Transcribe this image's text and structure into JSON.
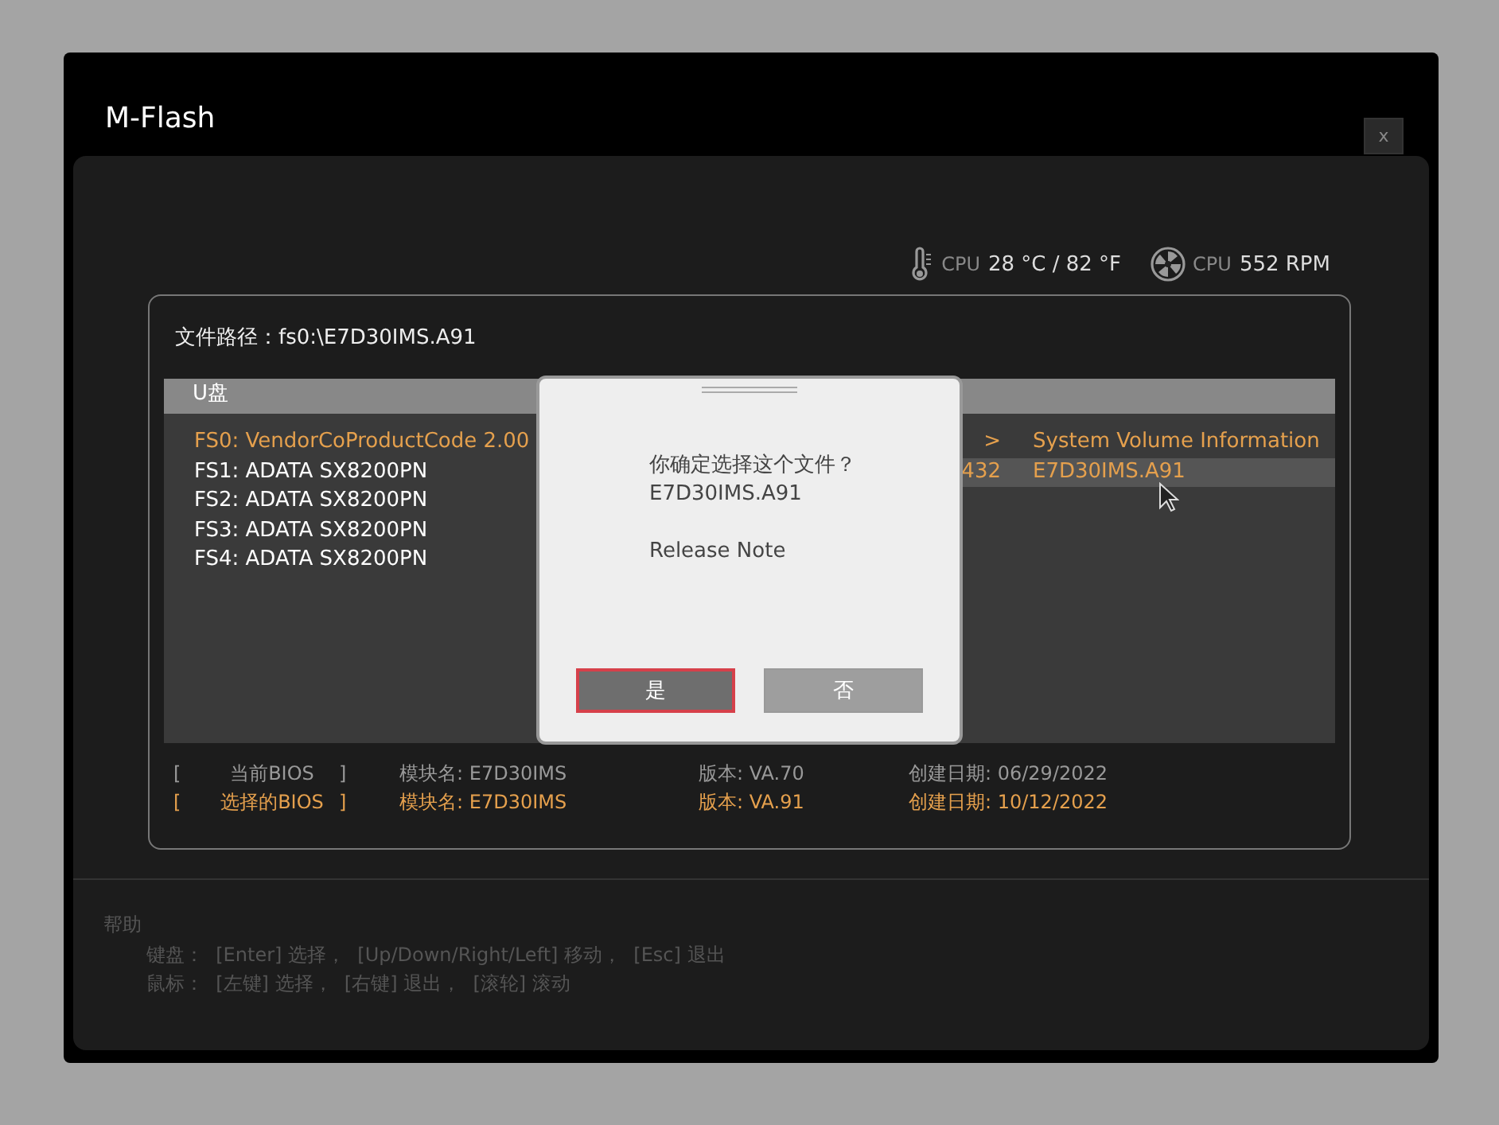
{
  "window": {
    "title": "M-Flash",
    "close": "x"
  },
  "sensors": [
    {
      "kind": "temperature",
      "label": "CPU",
      "value": "28 °C / 82 °F"
    },
    {
      "kind": "fan",
      "label": "CPU",
      "value": "552 RPM"
    }
  ],
  "file_path": "文件路径：fs0:\\E7D30IMS.A91",
  "drive_list": {
    "header": "U盘",
    "drives": [
      {
        "label": "FS0: VendorCoProductCode 2.00",
        "selected": true
      },
      {
        "label": "FS1: ADATA SX8200PN",
        "selected": false
      },
      {
        "label": "FS2: ADATA SX8200PN",
        "selected": false
      },
      {
        "label": "FS3: ADATA SX8200PN",
        "selected": false
      },
      {
        "label": "FS4: ADATA SX8200PN",
        "selected": false
      }
    ]
  },
  "files": [
    {
      "column_1": ">",
      "column_2": "System Volume Information",
      "selected": false
    },
    {
      "column_1": "432",
      "column_2": "E7D30IMS.A91",
      "selected": true
    }
  ],
  "bios_info": [
    {
      "open": "[",
      "label": "当前BIOS",
      "close": "]",
      "module": "模块名: E7D30IMS",
      "version": "版本: VA.70",
      "date": "创建日期: 06/29/2022",
      "selected": false
    },
    {
      "open": "[",
      "label": "选择的BIOS",
      "close": "]",
      "module": "模块名: E7D30IMS",
      "version": "版本: VA.91",
      "date": "创建日期: 10/12/2022",
      "selected": true
    }
  ],
  "help": {
    "title": "帮助",
    "lines": [
      "键盘：  [Enter] 选择，  [Up/Down/Right/Left] 移动，  [Esc] 退出",
      "鼠标：  [左键] 选择，  [右键] 退出，  [滚轮] 滚动"
    ]
  },
  "dialog": {
    "message": [
      "你确定选择这个文件？",
      "E7D30IMS.A91"
    ],
    "note": "Release Note",
    "buttons": [
      {
        "label": "是",
        "selected": true
      },
      {
        "label": "否",
        "selected": false
      }
    ]
  }
}
